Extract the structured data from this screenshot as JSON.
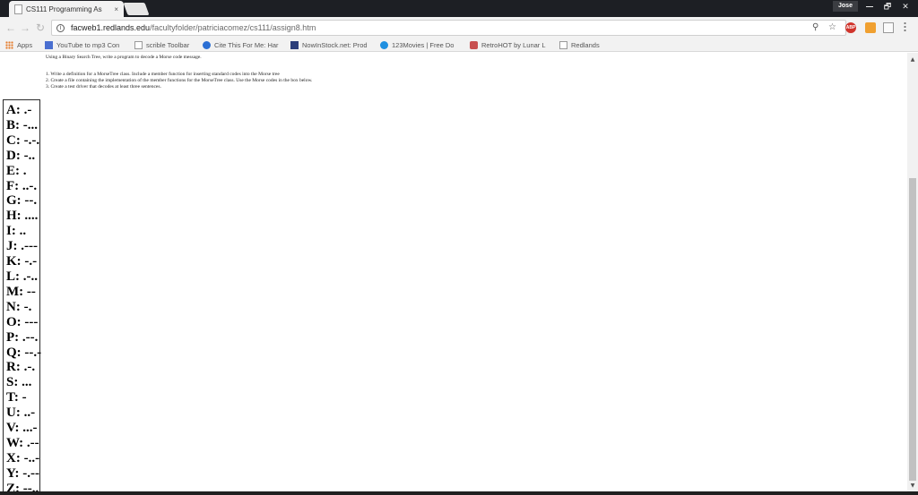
{
  "browser": {
    "tab_title": "CS111 Programming As",
    "tab_close": "×",
    "profile_name": "Jose",
    "window_controls": {
      "maximize": "🗗",
      "close": "✕"
    },
    "url_host": "facweb1.redlands.edu",
    "url_path": "/facultyfolder/patriciacomez/cs111/assign8.htm",
    "nav_icons": [
      "back-icon",
      "forward-icon",
      "reload-icon"
    ],
    "omnibox_icons": {
      "zoom": "⚲",
      "star": "☆"
    },
    "extensions": [
      {
        "name": "adblock-plus-icon",
        "label": "ABP"
      },
      {
        "name": "orange-extension-icon",
        "label": ""
      },
      {
        "name": "pdf-extension-icon",
        "label": ""
      }
    ]
  },
  "bookmarks": [
    {
      "icon": "apps",
      "label": "Apps"
    },
    {
      "icon": "yt",
      "label": "YouTube to mp3 Con"
    },
    {
      "icon": "page",
      "label": "scrible Toolbar"
    },
    {
      "icon": "cite",
      "label": "Cite This For Me: Har"
    },
    {
      "icon": "nis",
      "label": "NowInStock.net: Prod"
    },
    {
      "icon": "mov",
      "label": "123Movies | Free Do"
    },
    {
      "icon": "retro",
      "label": "RetroHOT by Lunar L"
    },
    {
      "icon": "page",
      "label": "Redlands"
    }
  ],
  "assignment": {
    "intro": "Using a Binary Search Tree, write a program to decode a Morse code message.",
    "steps": [
      "1. Write a definition for a MorseTree class. Include a member function for inserting standard codes into the Morse tree",
      "2. Create a file containing the implementation of the member functions for the MorseTree class. Use the Morse codes in the box below.",
      "3. Create a test driver that decodes at least three sentences."
    ]
  },
  "morse_codes": [
    "A: .-",
    "B: -...",
    "C: -.-.",
    "D: -..",
    "E: .",
    "F: ..-.",
    "G: --.",
    "H: ....",
    "I: ..",
    "J: .---",
    "K: -.-",
    "L: .-..",
    "M: --",
    "N: -.",
    "O: ---",
    "P: .--.",
    "Q: --.-",
    "R: .-.",
    "S: ...",
    "T: -",
    "U: ..-",
    "V: ...-",
    "W: .--",
    "X: -..-",
    "Y: -.--",
    "Z: --.."
  ],
  "scrollbar": {
    "up": "▲",
    "down": "▼"
  }
}
